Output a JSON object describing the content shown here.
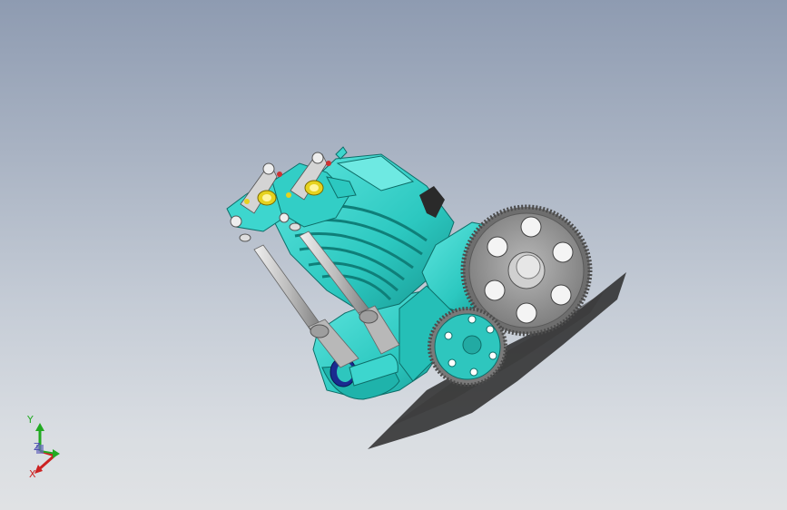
{
  "viewport": {
    "background_top": "#8e9bb1",
    "background_bottom": "#e0e2e4",
    "model": {
      "body_color": "#2fd1c9",
      "gear_color": "#8f8f8f",
      "rocker_color": "#c8c8c8",
      "accent_yellow": "#e6d21f",
      "shadow_color": "#2a2a2a"
    }
  },
  "triad": {
    "y_label": "Y",
    "z_label": "Z",
    "x_label": "X",
    "y_color": "#22aa22",
    "x_color": "#cc2222",
    "z_color": "#4a4ab0"
  }
}
